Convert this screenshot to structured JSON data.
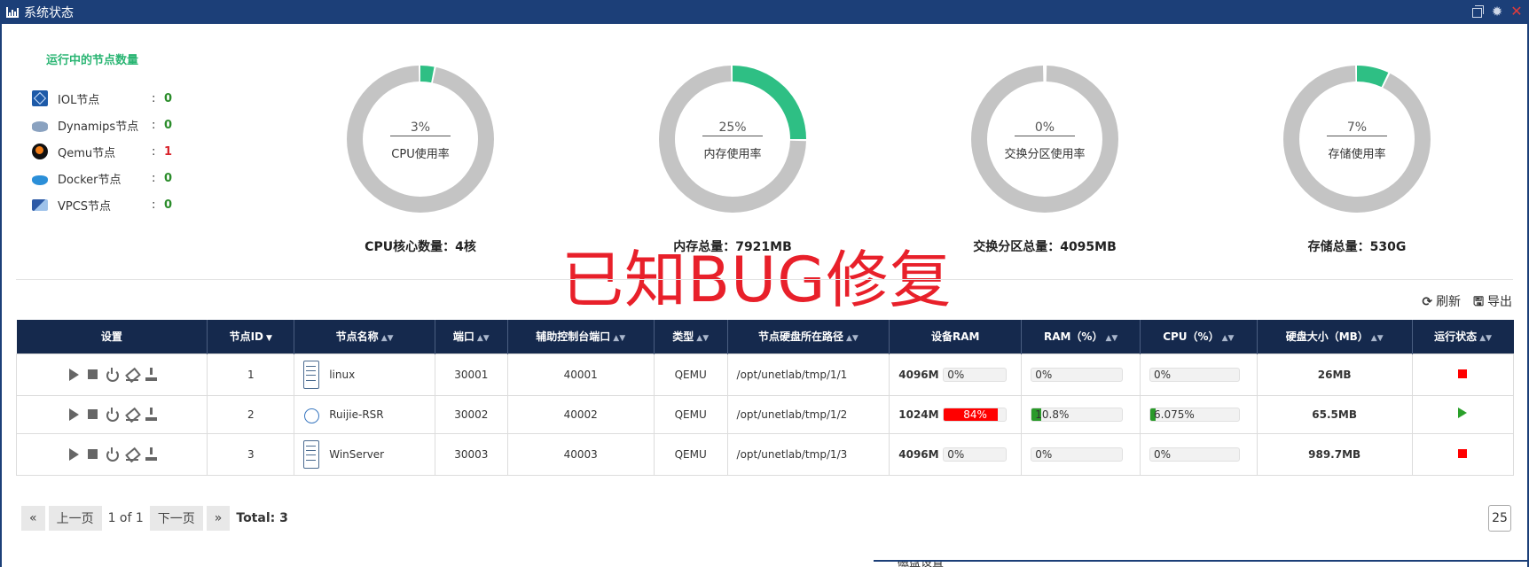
{
  "window": {
    "title": "系统状态"
  },
  "nodes": {
    "title": "运行中的节点数量",
    "items": [
      {
        "label": "IOL节点",
        "count": "0",
        "icon": "iol-icon",
        "colon": ":"
      },
      {
        "label": "Dynamips节点",
        "count": "0",
        "icon": "dynamips-icon",
        "colon": ":"
      },
      {
        "label": "Qemu节点",
        "count": "1",
        "icon": "qemu-icon",
        "colon": ":"
      },
      {
        "label": "Docker节点",
        "count": "0",
        "icon": "docker-icon",
        "colon": ":"
      },
      {
        "label": "VPCS节点",
        "count": "0",
        "icon": "vpcs-icon",
        "colon": ":"
      }
    ]
  },
  "usage": [
    {
      "pct_text": "3%",
      "value": 3,
      "label": "CPU使用率",
      "total": "CPU核心数量：4核"
    },
    {
      "pct_text": "25%",
      "value": 25,
      "label": "内存使用率",
      "total": "内存总量：7921MB"
    },
    {
      "pct_text": "0%",
      "value": 0,
      "label": "交换分区使用率",
      "total": "交换分区总量：4095MB"
    },
    {
      "pct_text": "7%",
      "value": 7,
      "label": "存储使用率",
      "total": "存储总量：530G"
    }
  ],
  "colors": {
    "used": "#2ebf84",
    "free": "#c4c4c4",
    "header_bg": "#15294d",
    "title_bg": "#1c3f78",
    "ram_high": "#ff0000",
    "bar_green": "#2a9a2a"
  },
  "overlay": {
    "text": "已知BUG修复"
  },
  "toolbar": {
    "refresh": "刷新",
    "export": "导出"
  },
  "table": {
    "headers": [
      "设置",
      "节点ID",
      "节点名称",
      "端口",
      "辅助控制台端口",
      "类型",
      "节点硬盘所在路径",
      "设备RAM",
      "RAM（%）",
      "CPU（%）",
      "硬盘大小（MB）",
      "运行状态"
    ],
    "rows": [
      {
        "id": "1",
        "name": "linux",
        "port": "30001",
        "aux": "40001",
        "type": "QEMU",
        "path": "/opt/unetlab/tmp/1/1",
        "ram": "4096M",
        "ram_pct": "0%",
        "ram_pct_val": 0,
        "ram_used": "0%",
        "ram_used_val": 0,
        "cpu": "0%",
        "cpu_val": 0,
        "disk": "26MB",
        "status": "stopped"
      },
      {
        "id": "2",
        "name": "Ruijie-RSR",
        "port": "30002",
        "aux": "40002",
        "type": "QEMU",
        "path": "/opt/unetlab/tmp/1/2",
        "ram": "1024M",
        "ram_pct": "84%",
        "ram_pct_val": 84,
        "ram_used": "10.8%",
        "ram_used_val": 10.8,
        "cpu": "6.075%",
        "cpu_val": 6.075,
        "disk": "65.5MB",
        "status": "running"
      },
      {
        "id": "3",
        "name": "WinServer",
        "port": "30003",
        "aux": "40003",
        "type": "QEMU",
        "path": "/opt/unetlab/tmp/1/3",
        "ram": "4096M",
        "ram_pct": "0%",
        "ram_pct_val": 0,
        "ram_used": "0%",
        "ram_used_val": 0,
        "cpu": "0%",
        "cpu_val": 0,
        "disk": "989.7MB",
        "status": "stopped"
      }
    ]
  },
  "pager": {
    "first": "«",
    "prev": "上一页",
    "info": "1 of 1",
    "next": "下一页",
    "last": "»",
    "total": "Total: 3",
    "page_size": "25"
  },
  "bottom": {
    "partial_text": "磁盘设置"
  }
}
